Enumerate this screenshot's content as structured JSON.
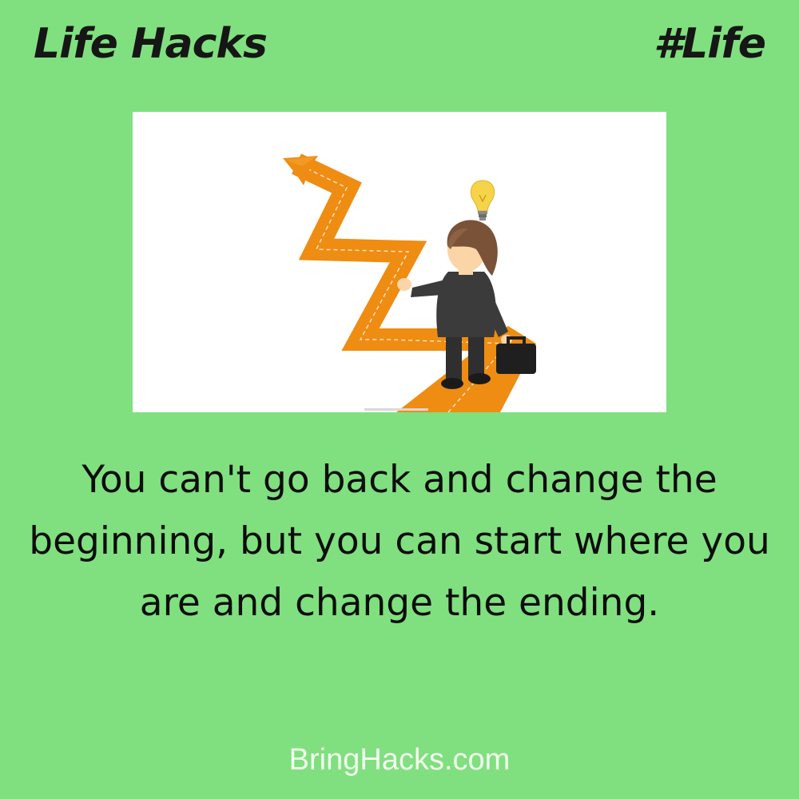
{
  "header": {
    "title": "Life Hacks",
    "tag": "#Life"
  },
  "illustration": {
    "description_icon": "businessman-walking-zigzag-arrow-illustration",
    "colors": {
      "arrow": "#ef8c12",
      "suit": "#3b3b3b",
      "hair": "#7a5238",
      "skin": "#fbd5a8",
      "bulb": "#f6d44a"
    }
  },
  "quote": {
    "text": "You can't go back and change the beginning, but you can start where you are and change the ending."
  },
  "footer": {
    "site": "BringHacks.com"
  },
  "colors": {
    "background": "#80e07f",
    "text": "#0d0d0d",
    "footer_text": "#f3fbef"
  }
}
